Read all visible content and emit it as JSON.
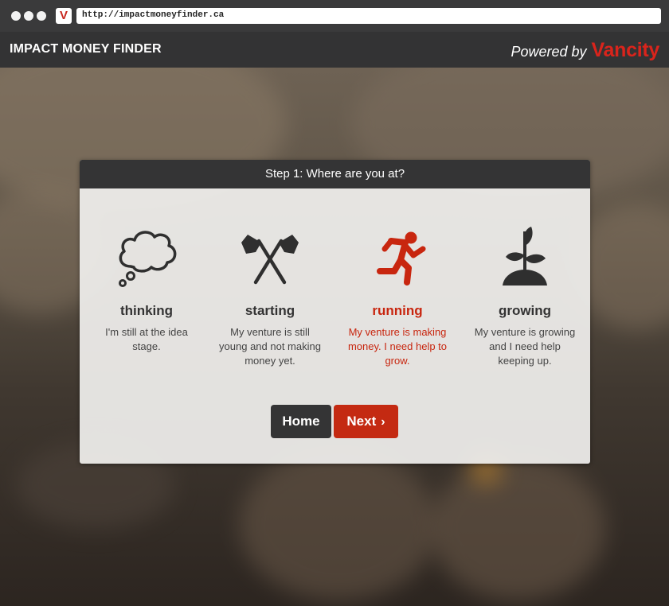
{
  "browser": {
    "url": "http://impactmoneyfinder.ca",
    "favicon_letter": "V"
  },
  "header": {
    "brand": "IMPACT MONEY FINDER",
    "powered_by": "Powered by",
    "partner": "Vancity"
  },
  "modal": {
    "title": "Step 1: Where are you at?",
    "options": [
      {
        "icon": "thought-bubble-icon",
        "label": "thinking",
        "description": "I'm still at the idea stage.",
        "selected": false
      },
      {
        "icon": "crossed-flags-icon",
        "label": "starting",
        "description": "My venture is still young and not making money yet.",
        "selected": false
      },
      {
        "icon": "running-person-icon",
        "label": "running",
        "description": "My venture is making money. I need help to grow.",
        "selected": true
      },
      {
        "icon": "sprout-plant-icon",
        "label": "growing",
        "description": "My venture is growing and I need help keeping up.",
        "selected": false
      }
    ],
    "home_label": "Home",
    "next_label": "Next",
    "next_chevron": "›"
  },
  "colors": {
    "accent": "#c8260f",
    "header_bg": "#333334",
    "brand_red": "#d9241c"
  }
}
